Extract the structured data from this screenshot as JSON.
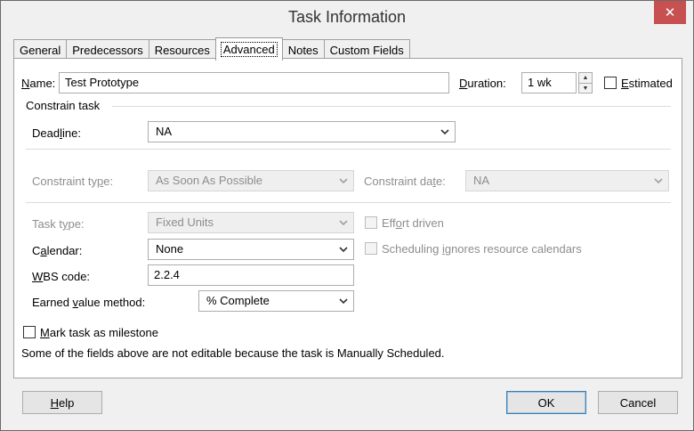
{
  "window": {
    "title": "Task Information",
    "close_glyph": "✕"
  },
  "tabs": [
    {
      "label": "General"
    },
    {
      "label": "Predecessors"
    },
    {
      "label": "Resources"
    },
    {
      "label": "Advanced",
      "active": true
    },
    {
      "label": "Notes"
    },
    {
      "label": "Custom Fields"
    }
  ],
  "form": {
    "name": {
      "label_u": "N",
      "label_rest": "ame:",
      "value": "Test Prototype"
    },
    "duration": {
      "label_u": "D",
      "label_rest": "uration:",
      "value": "1 wk"
    },
    "estimated": {
      "label_u": "E",
      "label_rest": "stimated",
      "checked": false
    },
    "constrain_heading": "Constrain task",
    "deadline": {
      "label_pre": "Dead",
      "label_u": "l",
      "label_rest": "ine:",
      "value": "NA"
    },
    "constraint_type": {
      "label_pre": "Constraint ty",
      "label_u": "p",
      "label_rest": "e:",
      "value": "As Soon As Possible",
      "disabled": true
    },
    "constraint_date": {
      "label_pre": "Constraint da",
      "label_u": "t",
      "label_rest": "e:",
      "value": "NA",
      "disabled": true
    },
    "task_type": {
      "label_pre": "Task t",
      "label_u": "y",
      "label_rest": "pe:",
      "value": "Fixed Units",
      "disabled": true
    },
    "effort_driven": {
      "label_pre": "Eff",
      "label_u": "o",
      "label_rest": "rt driven",
      "disabled": true
    },
    "calendar": {
      "label_pre": "C",
      "label_u": "a",
      "label_rest": "lendar:",
      "value": "None"
    },
    "scheduling_ignores": {
      "label_pre": "Scheduling ",
      "label_u": "i",
      "label_rest": "gnores resource calendars",
      "disabled": true
    },
    "wbs": {
      "label_u": "W",
      "label_rest": "BS code:",
      "value": "2.2.4"
    },
    "earned_value": {
      "label_pre": "Earned ",
      "label_u": "v",
      "label_rest": "alue method:",
      "value": "% Complete"
    },
    "milestone": {
      "label_u": "M",
      "label_rest": "ark task as milestone",
      "checked": false
    },
    "note": "Some of the fields above are not editable because the task is Manually Scheduled."
  },
  "buttons": {
    "help": {
      "label_u": "H",
      "label_rest": "elp"
    },
    "ok": "OK",
    "cancel": "Cancel"
  },
  "colors": {
    "close_bg": "#c75050",
    "dialog_bg": "#f0f0f0",
    "disabled_text": "#8d8d8d"
  },
  "icons": [
    "close-icon",
    "chevron-down-icon",
    "spin-up-icon",
    "spin-down-icon",
    "checkbox-icon"
  ]
}
